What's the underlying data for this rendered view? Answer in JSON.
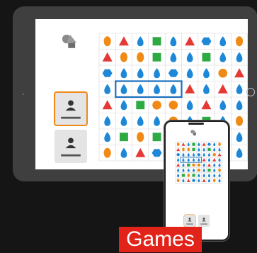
{
  "caption": {
    "text": "Games"
  },
  "app": {
    "icon": "shapes-icon"
  },
  "colors": {
    "red": "#e53935",
    "orange": "#ef8a17",
    "blue": "#1e88d8",
    "green": "#2eaa43",
    "highlight": "#1a6fbd"
  },
  "board": {
    "rows": [
      [
        "orange",
        "triangle",
        "drop",
        "green",
        "drop",
        "triangle",
        "hexagon",
        "drop",
        "orange"
      ],
      [
        "triangle",
        "orange",
        "orange",
        "green",
        "drop",
        "drop",
        "green",
        "drop",
        "drop"
      ],
      [
        "hexagon",
        "drop",
        "drop",
        "drop",
        "hexagon",
        "drop",
        "drop",
        "circle",
        "triangle"
      ],
      [
        "drop",
        "drop",
        "drop",
        "drop",
        "drop",
        "triangle",
        "drop",
        "triangle",
        "drop"
      ],
      [
        "triangle",
        "drop",
        "green",
        "circle",
        "circle",
        "drop",
        "triangle",
        "drop",
        "drop"
      ],
      [
        "drop",
        "drop",
        "drop",
        "drop",
        "circle",
        "drop",
        "green",
        "drop",
        "orange"
      ],
      [
        "drop",
        "green",
        "orange",
        "green",
        "drop",
        "drop",
        "drop",
        "drop",
        "drop"
      ],
      [
        "orange",
        "drop",
        "triangle",
        "hexagon",
        "drop",
        "triangle",
        "drop",
        "orange",
        "drop"
      ]
    ],
    "selected_row": 3,
    "selected_cols": [
      1,
      2,
      3,
      4
    ]
  },
  "players": [
    {
      "name": "player-1",
      "active": true
    },
    {
      "name": "player-2",
      "active": false
    }
  ]
}
